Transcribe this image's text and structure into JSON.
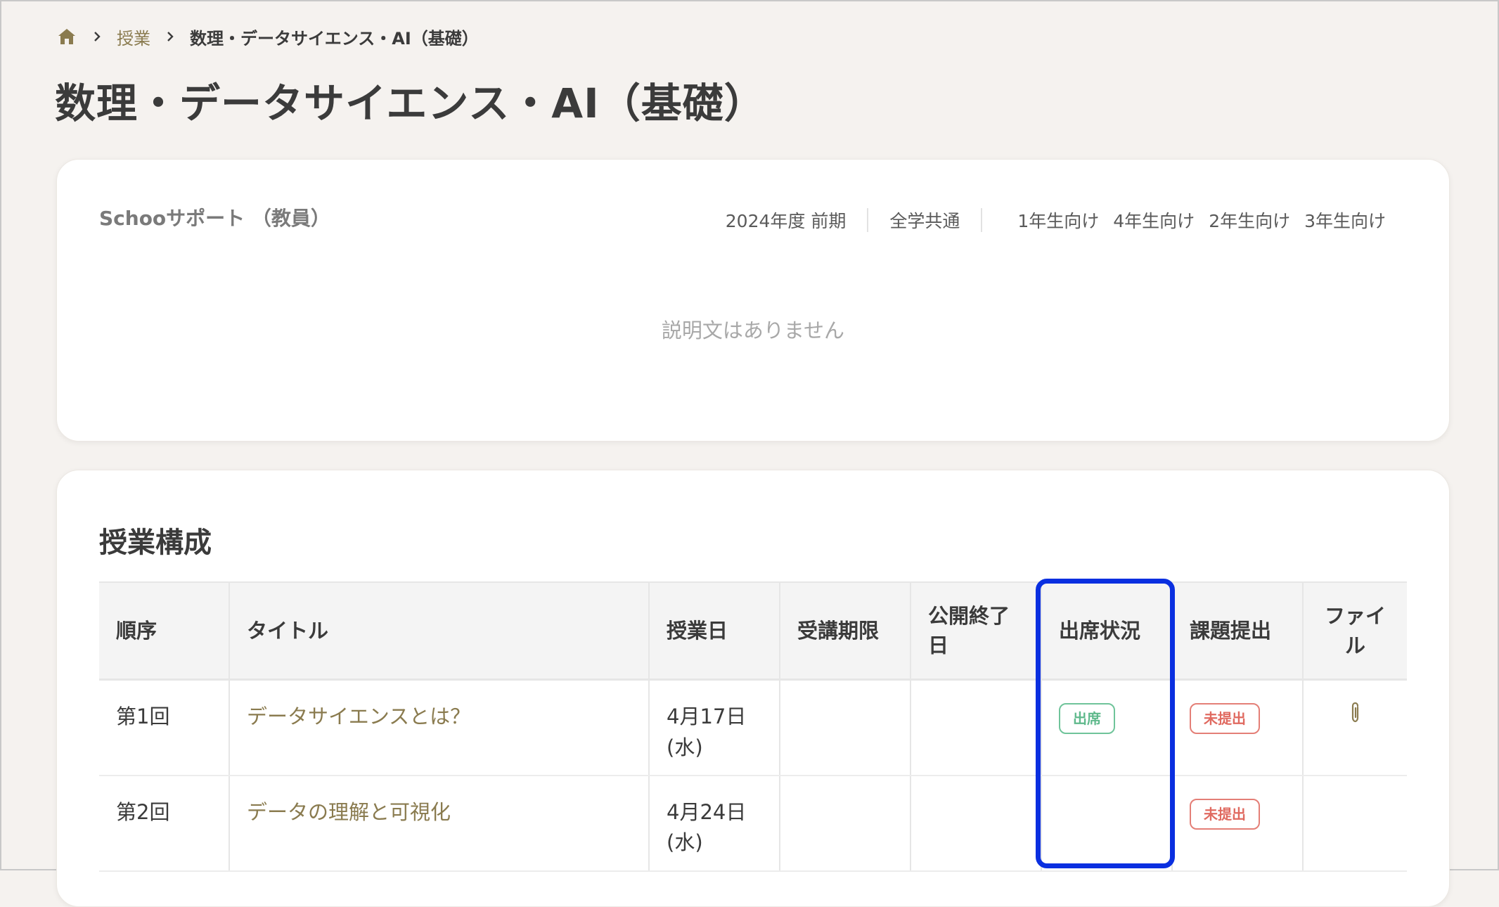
{
  "breadcrumb": {
    "home_icon": "home-icon",
    "separator_icon": "chevron-right-icon",
    "parent": "授業",
    "current": "数理・データサイエンス・AI（基礎）"
  },
  "page": {
    "title": "数理・データサイエンス・AI（基礎）"
  },
  "info": {
    "provider": "Schooサポート （教員）",
    "term": "2024年度 前期",
    "scope": "全学共通",
    "grades": [
      "1年生向け",
      "4年生向け",
      "2年生向け",
      "3年生向け"
    ],
    "description_placeholder": "説明文はありません"
  },
  "course": {
    "section_title": "授業構成",
    "columns": {
      "order": "順序",
      "title": "タイトル",
      "date": "授業日",
      "deadline": "受講期限",
      "publish_end": "公開終了日",
      "attendance": "出席状況",
      "assignment": "課題提出",
      "file": "ファイル"
    },
    "rows": [
      {
        "order": "第1回",
        "title": "データサイエンスとは？",
        "date_line1": "4月17日",
        "date_line2": "(水)",
        "deadline": "",
        "publish_end": "",
        "attendance": "出席",
        "assignment": "未提出",
        "file_icon": "paperclip-icon"
      },
      {
        "order": "第2回",
        "title": "データの理解と可視化",
        "date_line1": "4月24日",
        "date_line2": "(水)",
        "deadline": "",
        "publish_end": "",
        "attendance": "",
        "assignment": "未提出",
        "file_icon": ""
      }
    ]
  },
  "colors": {
    "background": "#f5f2ef",
    "accent_link": "#8a7b4f",
    "attendance_badge": "#5fb98c",
    "unsubmitted_badge": "#e06a60",
    "highlight_box": "#0a2fe0"
  }
}
